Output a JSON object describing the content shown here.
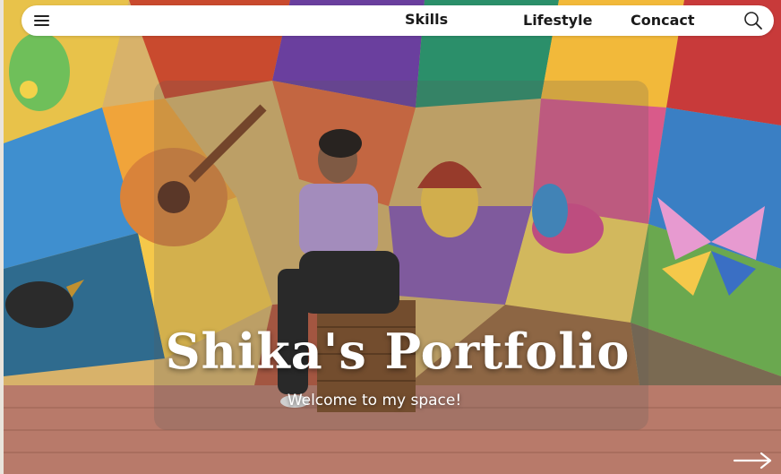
{
  "navbar": {
    "menu_icon": "hamburger-menu-icon",
    "links": [
      "Skills",
      "Lifestyle",
      "Concact"
    ],
    "search_icon": "search-icon"
  },
  "hero": {
    "title": "Shika's Portfolio",
    "subtitle": "Welcome to my space!",
    "next_icon": "arrow-right-icon"
  },
  "colors": {
    "navbar_bg": "#ffffff",
    "title_text": "#ffffff"
  }
}
